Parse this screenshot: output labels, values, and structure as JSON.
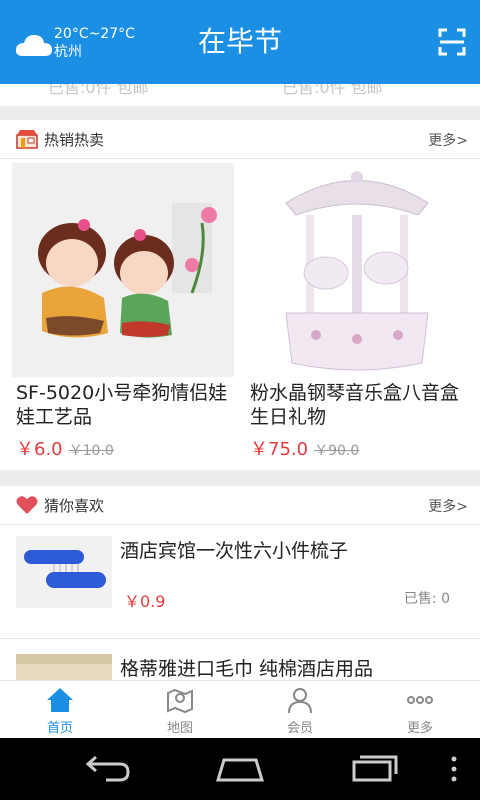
{
  "header": {
    "temperature": "20°C~27°C",
    "city": "杭州",
    "title": "在毕节",
    "icon_weather": "cloud-icon",
    "icon_scan": "scan-icon"
  },
  "peek": {
    "left_text": "已售:0件    包邮",
    "right_text": "已售:0件    包邮"
  },
  "hot": {
    "title": "热销热卖",
    "more": "更多>",
    "products": [
      {
        "name": "SF-5020小号牵狗情侣娃娃工艺品",
        "price": "￥6.0",
        "original_price": "￥10.0"
      },
      {
        "name": "粉水晶钢琴音乐盒八音盒生日礼物",
        "price": "￥75.0",
        "original_price": "￥90.0"
      }
    ]
  },
  "guess": {
    "title": "猜你喜欢",
    "more": "更多>",
    "items": [
      {
        "name": "酒店宾馆一次性六小件梳子",
        "price": "￥0.9",
        "sold": "已售: 0"
      },
      {
        "name": "格蒂雅进口毛巾 纯棉酒店用品",
        "price": "",
        "sold": ""
      }
    ]
  },
  "tabbar": {
    "tabs": [
      {
        "label": "首页",
        "icon": "home-icon",
        "active": true
      },
      {
        "label": "地图",
        "icon": "map-icon",
        "active": false
      },
      {
        "label": "会员",
        "icon": "user-icon",
        "active": false
      },
      {
        "label": "更多",
        "icon": "more-icon",
        "active": false
      }
    ]
  },
  "colors": {
    "brand": "#1a8fe3",
    "price": "#e53b3b",
    "heart": "#e0505a"
  }
}
